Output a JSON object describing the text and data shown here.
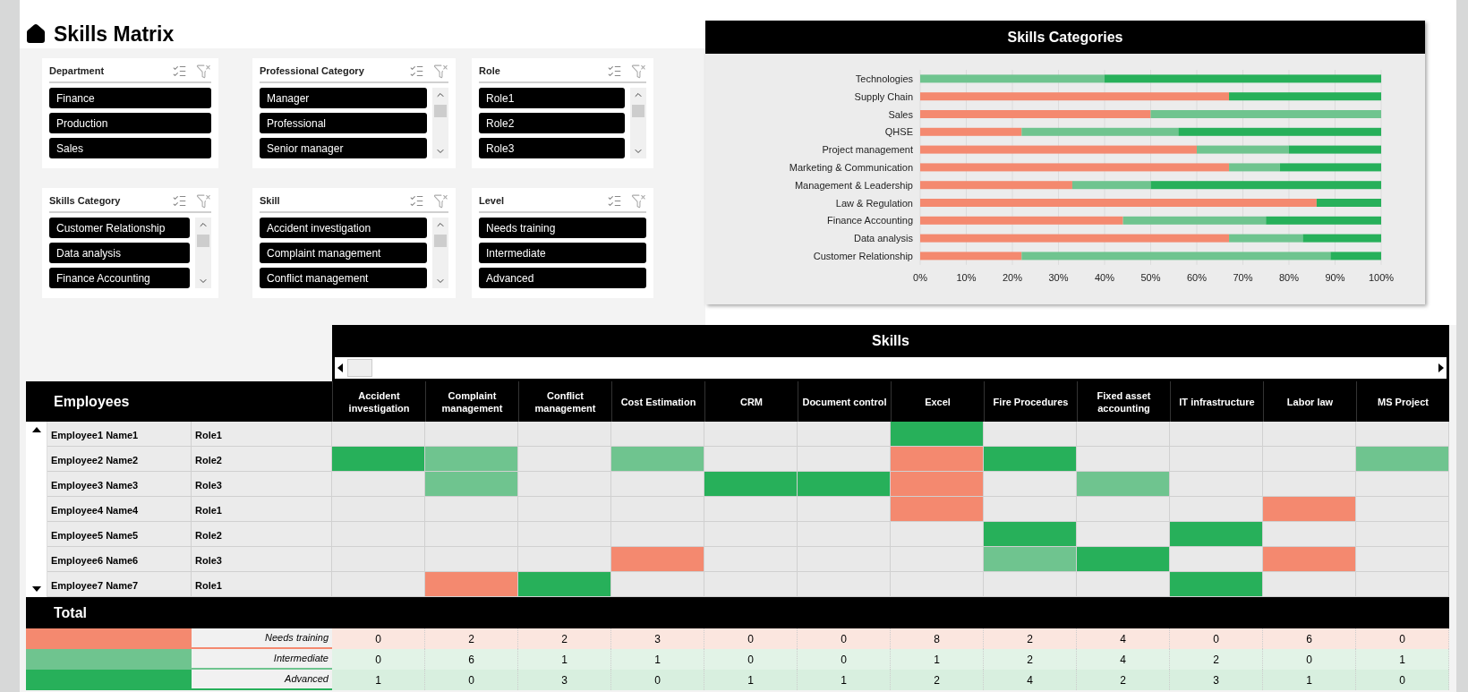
{
  "title": "Skills Matrix",
  "slicers": [
    {
      "title": "Department",
      "scrollbar": false,
      "items": [
        {
          "label": "Finance",
          "selected": true
        },
        {
          "label": "Production",
          "selected": true
        },
        {
          "label": "Sales",
          "selected": true
        }
      ]
    },
    {
      "title": "Professional Category",
      "scrollbar": true,
      "items": [
        {
          "label": "Manager",
          "selected": true
        },
        {
          "label": "Professional",
          "selected": true
        },
        {
          "label": "Senior manager",
          "selected": true
        }
      ]
    },
    {
      "title": "Role",
      "scrollbar": true,
      "items": [
        {
          "label": "Role1",
          "selected": true
        },
        {
          "label": "Role2",
          "selected": true
        },
        {
          "label": "Role3",
          "selected": true
        }
      ]
    },
    {
      "title": "Skills Category",
      "scrollbar": true,
      "items": [
        {
          "label": "Customer Relationship",
          "selected": true
        },
        {
          "label": "Data analysis",
          "selected": true
        },
        {
          "label": "Finance Accounting",
          "selected": true
        }
      ]
    },
    {
      "title": "Skill",
      "scrollbar": true,
      "items": [
        {
          "label": "Accident investigation",
          "selected": true
        },
        {
          "label": "Complaint management",
          "selected": true
        },
        {
          "label": "Conflict management",
          "selected": true
        }
      ]
    },
    {
      "title": "Level",
      "scrollbar": false,
      "items": [
        {
          "label": "Needs training",
          "selected": true
        },
        {
          "label": "Intermediate",
          "selected": true
        },
        {
          "label": "Advanced",
          "selected": true
        }
      ]
    }
  ],
  "chart": {
    "title": "Skills Categories",
    "chart_data": {
      "type": "bar",
      "orientation": "horizontal",
      "stacked": true,
      "categories": [
        "Technologies",
        "Supply Chain",
        "Sales",
        "QHSE",
        "Project management",
        "Marketing & Communication",
        "Management & Leadership",
        "Law & Regulation",
        "Finance Accounting",
        "Data analysis",
        "Customer Relationship"
      ],
      "series": [
        {
          "color": "#f4896f",
          "values": [
            0,
            0.67,
            0.5,
            0.22,
            0.6,
            0.67,
            0.33,
            0.86,
            0.44,
            0.67,
            0.22
          ]
        },
        {
          "color": "#6fc48f",
          "values": [
            0.4,
            0,
            0.5,
            0.34,
            0.2,
            0.11,
            0.17,
            0,
            0.31,
            0.16,
            0.67
          ]
        },
        {
          "color": "#27b05a",
          "values": [
            0.6,
            0.33,
            0,
            0.44,
            0.2,
            0.22,
            0.5,
            0.14,
            0.25,
            0.17,
            0.11
          ]
        }
      ],
      "xlim": [
        0,
        1
      ],
      "grid": true,
      "xticks": [
        {
          "value": 0,
          "label": "0%"
        },
        {
          "value": 0.1,
          "label": "10%"
        },
        {
          "value": 0.2,
          "label": "20%"
        },
        {
          "value": 0.3,
          "label": "30%"
        },
        {
          "value": 0.4,
          "label": "40%"
        },
        {
          "value": 0.5,
          "label": "50%"
        },
        {
          "value": 0.6,
          "label": "60%"
        },
        {
          "value": 0.7,
          "label": "70%"
        },
        {
          "value": 0.8,
          "label": "80%"
        },
        {
          "value": 0.9,
          "label": "90%"
        },
        {
          "value": 1,
          "label": "100%"
        }
      ]
    }
  },
  "matrix": {
    "skills_title": "Skills",
    "employees_title": "Employees",
    "total_title": "Total",
    "columns": [
      "Accident investigation",
      "Complaint management",
      "Conflict management",
      "Cost Estimation",
      "CRM",
      "Document control",
      "Excel",
      "Fire Procedures",
      "Fixed asset accounting",
      "IT infrastructure",
      "Labor law",
      "MS Project"
    ],
    "rows": [
      {
        "name": "Employee1 Name1",
        "role": "Role1",
        "cells": [
          {
            "color": "#e9e9e9"
          },
          {
            "color": "#e9e9e9"
          },
          {
            "color": "#e9e9e9"
          },
          {
            "color": "#e9e9e9"
          },
          {
            "color": "#e9e9e9"
          },
          {
            "color": "#e9e9e9"
          },
          {
            "color": "#27b05a"
          },
          {
            "color": "#e9e9e9"
          },
          {
            "color": "#e9e9e9"
          },
          {
            "color": "#e9e9e9"
          },
          {
            "color": "#e9e9e9"
          },
          {
            "color": "#e9e9e9"
          }
        ]
      },
      {
        "name": "Employee2 Name2",
        "role": "Role2",
        "cells": [
          {
            "color": "#27b05a"
          },
          {
            "color": "#6fc48f"
          },
          {
            "color": "#e9e9e9"
          },
          {
            "color": "#6fc48f"
          },
          {
            "color": "#e9e9e9"
          },
          {
            "color": "#e9e9e9"
          },
          {
            "color": "#f4896f"
          },
          {
            "color": "#27b05a"
          },
          {
            "color": "#e9e9e9"
          },
          {
            "color": "#e9e9e9"
          },
          {
            "color": "#e9e9e9"
          },
          {
            "color": "#6fc48f"
          }
        ]
      },
      {
        "name": "Employee3 Name3",
        "role": "Role3",
        "cells": [
          {
            "color": "#e9e9e9"
          },
          {
            "color": "#6fc48f"
          },
          {
            "color": "#e9e9e9"
          },
          {
            "color": "#e9e9e9"
          },
          {
            "color": "#27b05a"
          },
          {
            "color": "#27b05a"
          },
          {
            "color": "#f4896f"
          },
          {
            "color": "#e9e9e9"
          },
          {
            "color": "#6fc48f"
          },
          {
            "color": "#e9e9e9"
          },
          {
            "color": "#e9e9e9"
          },
          {
            "color": "#e9e9e9"
          }
        ]
      },
      {
        "name": "Employee4 Name4",
        "role": "Role1",
        "cells": [
          {
            "color": "#e9e9e9"
          },
          {
            "color": "#e9e9e9"
          },
          {
            "color": "#e9e9e9"
          },
          {
            "color": "#e9e9e9"
          },
          {
            "color": "#e9e9e9"
          },
          {
            "color": "#e9e9e9"
          },
          {
            "color": "#f4896f"
          },
          {
            "color": "#e9e9e9"
          },
          {
            "color": "#e9e9e9"
          },
          {
            "color": "#e9e9e9"
          },
          {
            "color": "#f4896f"
          },
          {
            "color": "#e9e9e9"
          }
        ]
      },
      {
        "name": "Employee5 Name5",
        "role": "Role2",
        "cells": [
          {
            "color": "#e9e9e9"
          },
          {
            "color": "#e9e9e9"
          },
          {
            "color": "#e9e9e9"
          },
          {
            "color": "#e9e9e9"
          },
          {
            "color": "#e9e9e9"
          },
          {
            "color": "#e9e9e9"
          },
          {
            "color": "#e9e9e9"
          },
          {
            "color": "#27b05a"
          },
          {
            "color": "#e9e9e9"
          },
          {
            "color": "#27b05a"
          },
          {
            "color": "#e9e9e9"
          },
          {
            "color": "#e9e9e9"
          }
        ]
      },
      {
        "name": "Employee6 Name6",
        "role": "Role3",
        "cells": [
          {
            "color": "#e9e9e9"
          },
          {
            "color": "#e9e9e9"
          },
          {
            "color": "#e9e9e9"
          },
          {
            "color": "#f4896f"
          },
          {
            "color": "#e9e9e9"
          },
          {
            "color": "#e9e9e9"
          },
          {
            "color": "#e9e9e9"
          },
          {
            "color": "#6fc48f"
          },
          {
            "color": "#27b05a"
          },
          {
            "color": "#e9e9e9"
          },
          {
            "color": "#f4896f"
          },
          {
            "color": "#e9e9e9"
          }
        ]
      },
      {
        "name": "Employee7 Name7",
        "role": "Role1",
        "cells": [
          {
            "color": "#e9e9e9"
          },
          {
            "color": "#f4896f"
          },
          {
            "color": "#27b05a"
          },
          {
            "color": "#e9e9e9"
          },
          {
            "color": "#e9e9e9"
          },
          {
            "color": "#e9e9e9"
          },
          {
            "color": "#e9e9e9"
          },
          {
            "color": "#e9e9e9"
          },
          {
            "color": "#e9e9e9"
          },
          {
            "color": "#27b05a"
          },
          {
            "color": "#e9e9e9"
          },
          {
            "color": "#e9e9e9"
          }
        ]
      }
    ],
    "totals": [
      {
        "label": "Needs training",
        "color": "#f4896f",
        "values": [
          "0",
          "2",
          "2",
          "3",
          "0",
          "0",
          "8",
          "2",
          "4",
          "0",
          "6",
          "0"
        ]
      },
      {
        "label": "Intermediate",
        "color": "#6fc48f",
        "values": [
          "0",
          "6",
          "1",
          "1",
          "0",
          "0",
          "1",
          "2",
          "4",
          "2",
          "0",
          "1"
        ]
      },
      {
        "label": "Advanced",
        "color": "#27b05a",
        "values": [
          "1",
          "0",
          "3",
          "0",
          "1",
          "1",
          "2",
          "4",
          "2",
          "3",
          "1",
          "0"
        ]
      }
    ]
  }
}
